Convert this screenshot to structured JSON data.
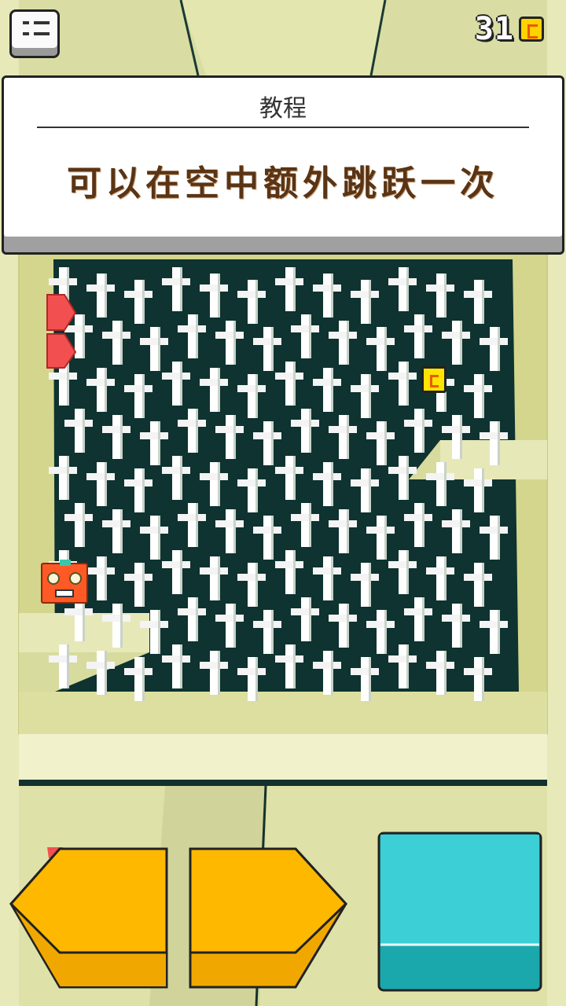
{
  "hud": {
    "coins": "31",
    "menu_icon": "menu-list-icon",
    "coin_icon": "coin-icon"
  },
  "tutorial": {
    "title": "教程",
    "message": "可以在空中额外跳跃一次"
  },
  "controls": {
    "left_icon": "left-arrow-button",
    "right_icon": "right-arrow-button",
    "jump_icon": "jump-button"
  },
  "colors": {
    "background": "#e6e8b4",
    "maze_wall": "#0c2f2c",
    "maze_floor": "#d7d88f",
    "spikes": "#ffffff",
    "player": "#ff5a26",
    "arrow_button": "#ffb400",
    "jump_button": "#3dcfd6",
    "coin": "#ffe400",
    "hazard": "#f25050"
  }
}
